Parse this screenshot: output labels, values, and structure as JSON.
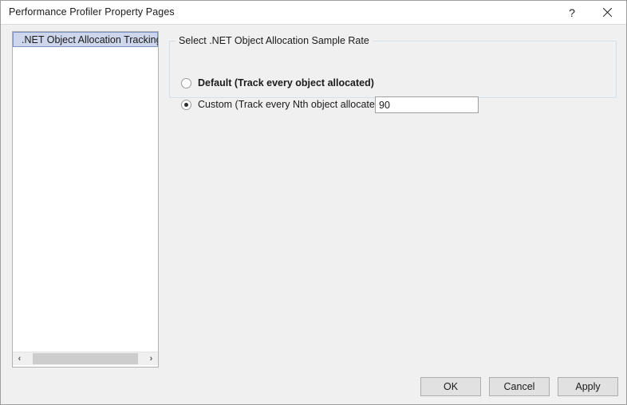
{
  "window": {
    "title": "Performance Profiler Property Pages",
    "help_icon": "help-question-icon",
    "help_glyph": "?",
    "close_icon": "close-icon",
    "border_color": "#9e9e9e",
    "background_color": "#f0f0f0"
  },
  "pagelist": {
    "items": [
      {
        "label": ".NET Object Allocation Tracking",
        "selected": true
      }
    ],
    "selected_background": "#cdd6eb",
    "selected_border": "#7d95c4",
    "scrollbar": {
      "left_arrow": "‹",
      "right_arrow": "›",
      "left_icon": "scroll-left-arrow-icon",
      "right_icon": "scroll-right-arrow-icon",
      "thumb_color": "#cdcdcd"
    }
  },
  "groupbox": {
    "label": "Select .NET Object Allocation Sample Rate",
    "border_color": "#d6e0ea",
    "options": [
      {
        "label": "Default (Track every object allocated)",
        "checked": false,
        "bold": true
      },
      {
        "label": "Custom (Track every Nth object allocated):",
        "checked": true,
        "bold": false
      }
    ],
    "nth_input": {
      "value": "90",
      "placeholder": ""
    }
  },
  "footer": {
    "ok_label": "OK",
    "cancel_label": "Cancel",
    "apply_label": "Apply"
  }
}
